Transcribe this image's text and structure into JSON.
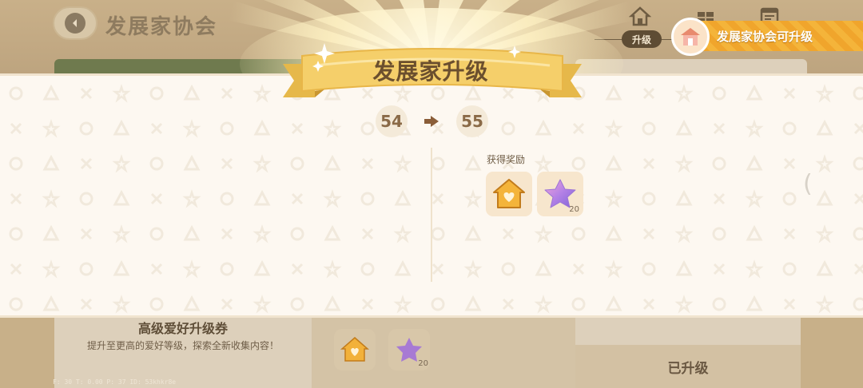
{
  "background": {
    "title": "发展家协会",
    "tab_label": "升级",
    "notification": "发展家协会可升级",
    "card_title": "高级爱好升级券",
    "card_desc": "提升至更高的爱好等级，探索全新收集内容！",
    "upgraded_label": "已升级",
    "item_count": "20",
    "debug_text": "F: 30    T: 0.00    P: 37    ID: 53khkr8e"
  },
  "popup": {
    "title": "发展家升级",
    "level_from": "54",
    "level_to": "55",
    "reward_label": "获得奖励",
    "rewards": [
      {
        "icon": "house-heart-icon",
        "count": ""
      },
      {
        "icon": "purple-star-icon",
        "count": "20"
      }
    ]
  },
  "colors": {
    "popup_bg": "#fdf8f1",
    "banner": "#f5cf6a",
    "text_brown": "#6b4f2e",
    "notification": "#f4b43a"
  }
}
